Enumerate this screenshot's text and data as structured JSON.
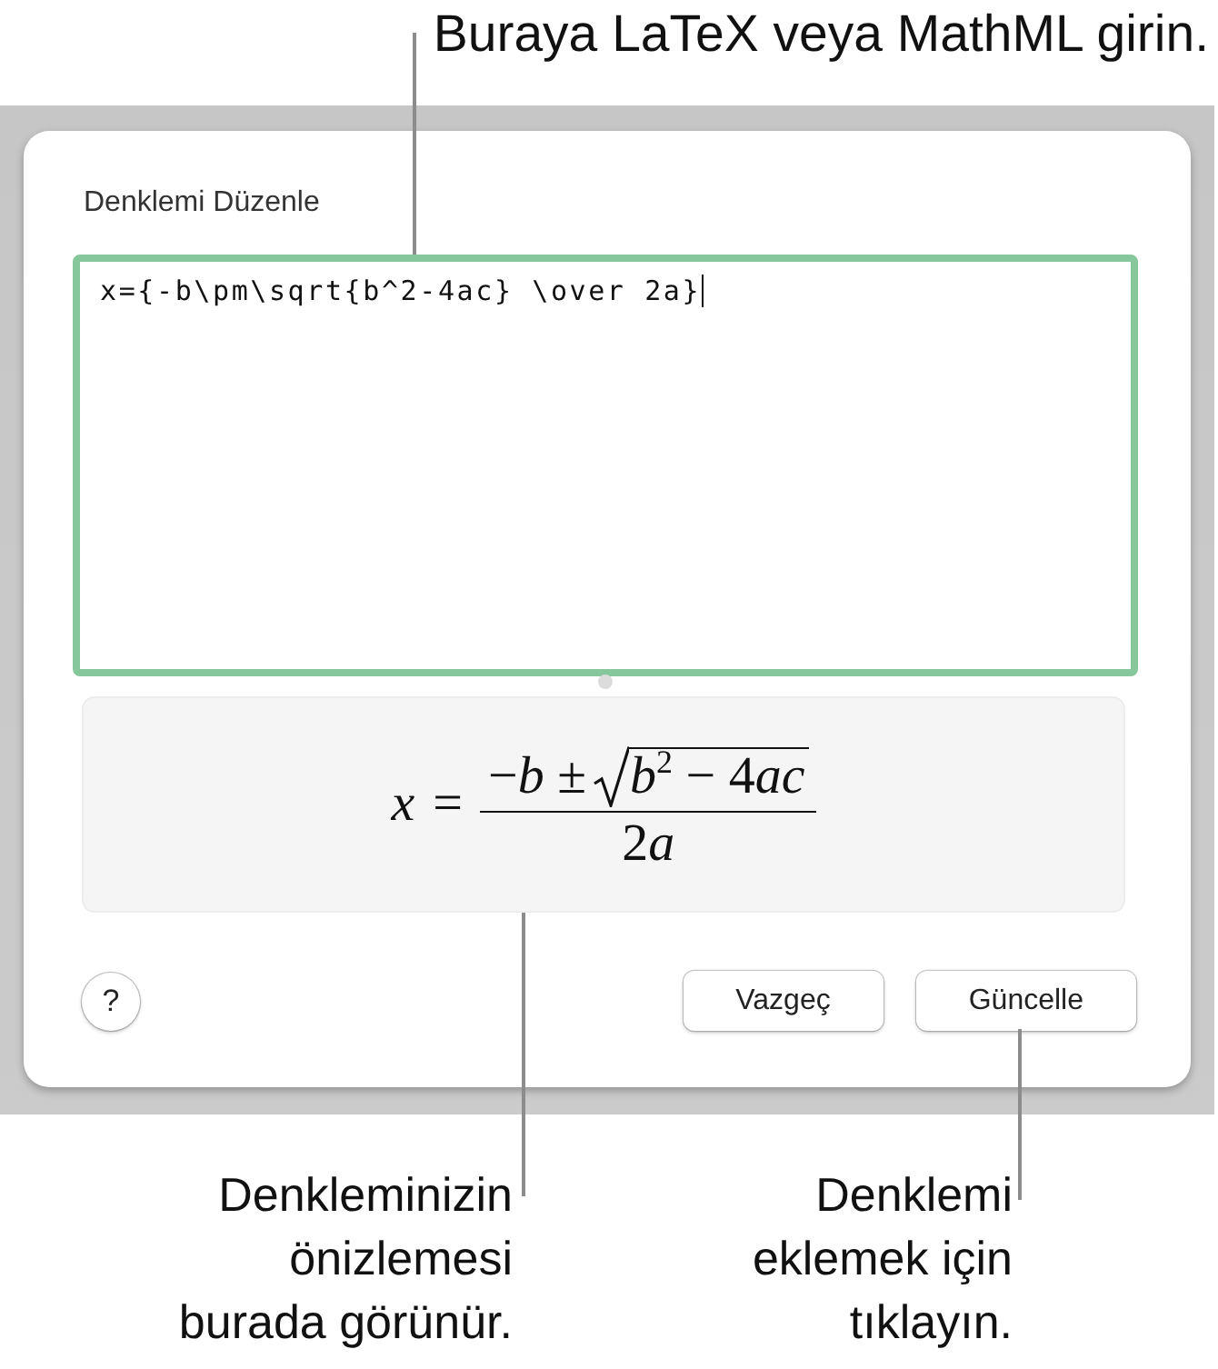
{
  "callouts_top": [
    {
      "text": "Buraya LaTeX veya MathML girin."
    }
  ],
  "dialog": {
    "label": "Denklemi Düzenle",
    "input": {
      "value": "x={-b\\pm\\sqrt{b^2-4ac} \\over 2a}",
      "focused": true
    },
    "preview": {
      "lhs": "x",
      "relation": "=",
      "numerator_term": [
        {
          "kind": "operator",
          "text": "−"
        },
        {
          "kind": "variable",
          "text": "b"
        },
        {
          "kind": "operator",
          "text": " ±"
        }
      ],
      "radicand": [
        {
          "kind": "variable",
          "text": "b"
        },
        {
          "kind": "exponent",
          "text": "2"
        },
        {
          "kind": "operator",
          "text": " − "
        },
        {
          "kind": "number",
          "text": "4"
        },
        {
          "kind": "variable",
          "text": "ac"
        }
      ],
      "denominator": [
        {
          "kind": "number",
          "text": "2"
        },
        {
          "kind": "variable",
          "text": "a"
        }
      ]
    },
    "help_button": {
      "label": "?"
    },
    "buttons": [
      {
        "label": "Vazgeç"
      },
      {
        "label": "Güncelle"
      }
    ]
  },
  "callouts_bottom": [
    {
      "text": "Denkleminizin\nönizlemesi\nburada görünür."
    },
    {
      "text": "Denklemi\neklemek için\ntıklayın."
    }
  ]
}
